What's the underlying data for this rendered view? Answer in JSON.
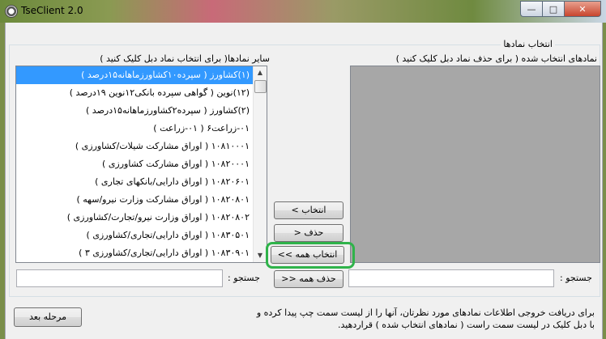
{
  "window": {
    "title": "TseClient 2.0",
    "min_glyph": "—",
    "max_glyph": "□",
    "close_glyph": "✕"
  },
  "group": {
    "title": "انتخاب نمادها"
  },
  "left_panel": {
    "header": "سایر نمادها( برای انتخاب نماد دبل کلیک کنید )",
    "items": [
      "(۱)کشاورز ( سپرده۱۰کشاورزماهانه۱۵درصد )",
      "(۱۲)نوین ( گواهی سپرده بانکی۱۲نوین ۱۹درصد )",
      "(۲)کشاورز ( سپرده۲کشاورزماهانه۱۵درصد )",
      "۰۱-زراعت۶ ( ۰۱-زراعت )",
      "۱۰۸۱۰۰۰۱ ( اوراق مشارکت شیلات/کشاورزی )",
      "۱۰۸۲۰۰۰۱ ( اوراق مشارکت کشاورزی )",
      "۱۰۸۲۰۶۰۱ ( اوراق دارایی/بانکهای تجاری )",
      "۱۰۸۲۰۸۰۱ ( اوراق مشارکت وزارت نیرو/سهه )",
      "۱۰۸۲۰۸۰۲ ( اوراق وزارت نیرو/تجارت/کشاورزی )",
      "۱۰۸۳۰۵۰۱ ( اوراق دارایی/تجاری/کشاورزی )",
      "۱۰۸۳۰۹۰۱ ( اوراق دارایی/تجاری/کشاورزی ۳ )"
    ],
    "selected_index": 0,
    "search_label": "جستجو :",
    "search_value": ""
  },
  "right_panel": {
    "header": "نمادهای انتخاب شده ( برای حذف نماد دبل کلیک کنید )",
    "items": [],
    "search_label": "جستجو :",
    "search_value": ""
  },
  "buttons": {
    "select": "انتخاب >",
    "remove": "حذف <",
    "select_all": "انتخاب همه >>",
    "remove_all": "حذف همه <<",
    "next_step": "مرحله بعد"
  },
  "instructions": "برای دریافت خروجی اطلاعات نمادهای مورد نظرتان، آنها را از لیست سمت چپ پیدا کرده و با دبل کلیک در لیست سمت راست ( نمادهای انتخاب شده ) قراردهید.",
  "colors": {
    "selection": "#3399ff",
    "highlight_ring": "#2fb34a",
    "selected_list_bg": "#a7a7a7"
  }
}
